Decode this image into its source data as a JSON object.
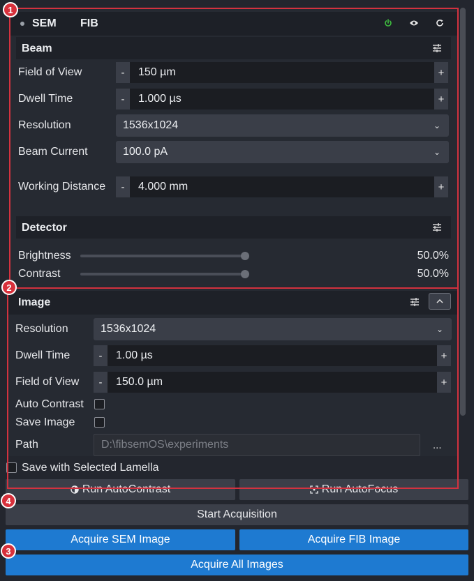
{
  "tabs": [
    "SEM",
    "FIB"
  ],
  "header_icons": {
    "power": "power-icon",
    "eye": "eye-icon",
    "refresh": "refresh-icon"
  },
  "beam": {
    "title": "Beam",
    "fov_label": "Field of View",
    "fov_value": "150 µm",
    "dwell_label": "Dwell Time",
    "dwell_value": "1.000 µs",
    "resolution_label": "Resolution",
    "resolution_value": "1536x1024",
    "current_label": "Beam Current",
    "current_value": "100.0 pA",
    "wd_label": "Working Distance",
    "wd_value": "4.000 mm"
  },
  "detector": {
    "title": "Detector",
    "brightness_label": "Brightness",
    "brightness_value": "50.0%",
    "brightness_fraction": 0.5,
    "contrast_label": "Contrast",
    "contrast_value": "50.0%",
    "contrast_fraction": 0.5
  },
  "image": {
    "title": "Image",
    "resolution_label": "Resolution",
    "resolution_value": "1536x1024",
    "dwell_label": "Dwell Time",
    "dwell_value": "1.00 µs",
    "fov_label": "Field of View",
    "fov_value": "150.0 µm",
    "auto_contrast_label": "Auto Contrast",
    "auto_contrast_checked": false,
    "save_image_label": "Save Image",
    "save_image_checked": false,
    "path_label": "Path",
    "path_placeholder": "D:\\fibsemOS\\experiments",
    "browse_label": "..."
  },
  "save_lamella_label": "Save with Selected Lamella",
  "buttons": {
    "autocontrast": "Run AutoContrast",
    "autofocus": "Run AutoFocus",
    "start": "Start Acquisition",
    "acquire_sem": "Acquire SEM Image",
    "acquire_fib": "Acquire FIB Image",
    "acquire_all": "Acquire All Images"
  },
  "stepper": {
    "minus": "-",
    "plus": "+"
  },
  "markers": [
    "1",
    "2",
    "3",
    "4"
  ],
  "colors": {
    "accent_blue": "#1e7ad1",
    "marker_red": "#d8303b",
    "power_green": "#3fbf3f"
  }
}
